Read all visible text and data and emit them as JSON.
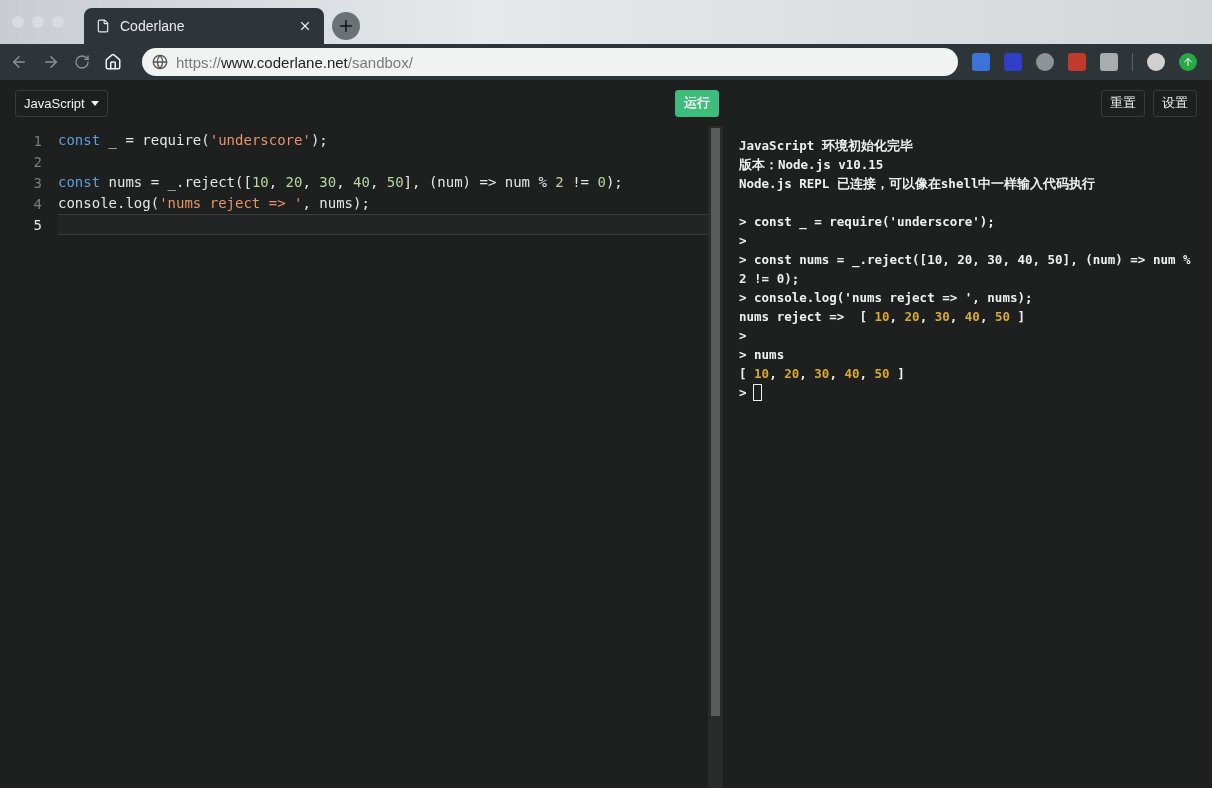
{
  "browser": {
    "tab": {
      "title": "Coderlane",
      "selected": true
    },
    "url": {
      "scheme": "https://",
      "host": "www.coderlane.net",
      "path": "/sandbox/"
    }
  },
  "toolbar": {
    "language": "JavaScript",
    "run": "运行",
    "reset": "重置",
    "settings": "设置"
  },
  "editor": {
    "lines": [
      {
        "number": "1",
        "active": false,
        "tokens": [
          {
            "kind": "kw",
            "text": "const"
          },
          {
            "kind": "plain",
            "text": " _ = require("
          },
          {
            "kind": "str",
            "text": "'underscore'"
          },
          {
            "kind": "plain",
            "text": ");"
          }
        ]
      },
      {
        "number": "2",
        "active": false
      },
      {
        "number": "3",
        "active": false,
        "tokens": [
          {
            "kind": "kw",
            "text": "const"
          },
          {
            "kind": "plain",
            "text": " nums = _.reject(["
          },
          {
            "kind": "num",
            "text": "10"
          },
          {
            "kind": "plain",
            "text": ", "
          },
          {
            "kind": "num",
            "text": "20"
          },
          {
            "kind": "plain",
            "text": ", "
          },
          {
            "kind": "num",
            "text": "30"
          },
          {
            "kind": "plain",
            "text": ", "
          },
          {
            "kind": "num",
            "text": "40"
          },
          {
            "kind": "plain",
            "text": ", "
          },
          {
            "kind": "num",
            "text": "50"
          },
          {
            "kind": "plain",
            "text": "], (num) => num % "
          },
          {
            "kind": "num",
            "text": "2"
          },
          {
            "kind": "plain",
            "text": " != "
          },
          {
            "kind": "num",
            "text": "0"
          },
          {
            "kind": "plain",
            "text": ");"
          }
        ]
      },
      {
        "number": "4",
        "active": false,
        "tokens": [
          {
            "kind": "plain",
            "text": "console.log("
          },
          {
            "kind": "str",
            "text": "'nums reject => '"
          },
          {
            "kind": "plain",
            "text": ", nums);"
          }
        ]
      },
      {
        "number": "5",
        "active": true
      }
    ]
  },
  "console": {
    "lines": [
      {
        "tokens": [
          {
            "kind": "plain",
            "text": "JavaScript 环境初始化完毕"
          }
        ]
      },
      {
        "tokens": [
          {
            "kind": "plain",
            "text": "版本：Node.js v10.15"
          }
        ]
      },
      {
        "tokens": [
          {
            "kind": "plain",
            "text": "Node.js REPL 已连接，可以像在shell中一样输入代码执行"
          }
        ]
      },
      {
        "kind": "blank"
      },
      {
        "tokens": [
          {
            "kind": "plain",
            "text": "> const _ = require('underscore');"
          }
        ]
      },
      {
        "tokens": [
          {
            "kind": "plain",
            "text": ">"
          }
        ]
      },
      {
        "tokens": [
          {
            "kind": "plain",
            "text": "> const nums = _.reject([10, 20, 30, 40, 50], (num) => num % 2 != 0);"
          }
        ]
      },
      {
        "tokens": [
          {
            "kind": "plain",
            "text": "> console.log('nums reject => ', nums);"
          }
        ]
      },
      {
        "tokens": [
          {
            "kind": "plain",
            "text": "nums reject =>  [ "
          },
          {
            "kind": "num",
            "text": "10"
          },
          {
            "kind": "plain",
            "text": ", "
          },
          {
            "kind": "num",
            "text": "20"
          },
          {
            "kind": "plain",
            "text": ", "
          },
          {
            "kind": "num",
            "text": "30"
          },
          {
            "kind": "plain",
            "text": ", "
          },
          {
            "kind": "num",
            "text": "40"
          },
          {
            "kind": "plain",
            "text": ", "
          },
          {
            "kind": "num",
            "text": "50"
          },
          {
            "kind": "plain",
            "text": " ]"
          }
        ]
      },
      {
        "tokens": [
          {
            "kind": "plain",
            "text": ">"
          }
        ]
      },
      {
        "tokens": [
          {
            "kind": "plain",
            "text": "> nums"
          }
        ]
      },
      {
        "tokens": [
          {
            "kind": "plain",
            "text": "[ "
          },
          {
            "kind": "num",
            "text": "10"
          },
          {
            "kind": "plain",
            "text": ", "
          },
          {
            "kind": "num",
            "text": "20"
          },
          {
            "kind": "plain",
            "text": ", "
          },
          {
            "kind": "num",
            "text": "30"
          },
          {
            "kind": "plain",
            "text": ", "
          },
          {
            "kind": "num",
            "text": "40"
          },
          {
            "kind": "plain",
            "text": ", "
          },
          {
            "kind": "num",
            "text": "50"
          },
          {
            "kind": "plain",
            "text": " ]"
          }
        ]
      }
    ],
    "prompt": ">"
  }
}
